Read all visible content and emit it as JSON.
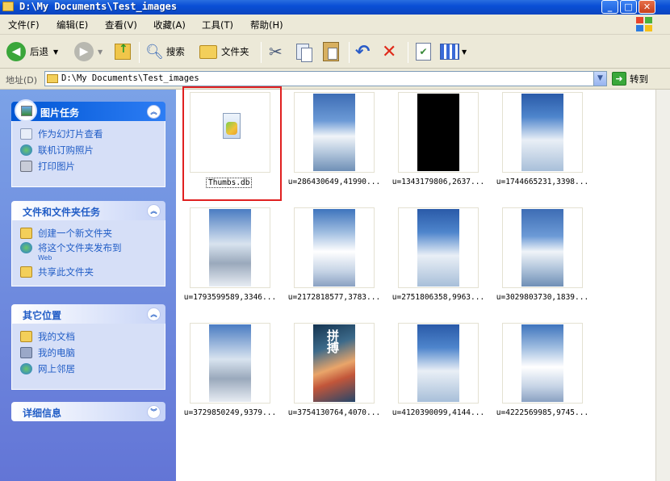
{
  "window": {
    "title": "D:\\My Documents\\Test_images"
  },
  "menu": [
    "文件(F)",
    "编辑(E)",
    "查看(V)",
    "收藏(A)",
    "工具(T)",
    "帮助(H)"
  ],
  "toolbar": {
    "back": "后退",
    "search": "搜索",
    "folders": "文件夹"
  },
  "address": {
    "label": "地址(D)",
    "path": "D:\\My Documents\\Test_images",
    "go": "转到"
  },
  "tasks": {
    "picture": {
      "title": "图片任务",
      "items": [
        "作为幻灯片查看",
        "联机订购照片",
        "打印图片"
      ]
    },
    "file": {
      "title": "文件和文件夹任务",
      "items": [
        "创建一个新文件夹",
        "将这个文件夹发布到",
        "Web",
        "共享此文件夹"
      ]
    },
    "other": {
      "title": "其它位置",
      "items": [
        "我的文档",
        "我的电脑",
        "网上邻居"
      ]
    },
    "details": {
      "title": "详细信息"
    }
  },
  "files": [
    {
      "name": "Thumbs.db",
      "kind": "db"
    },
    {
      "name": "u=286430649,41990...",
      "kind": "sky1"
    },
    {
      "name": "u=1343179806,2637...",
      "kind": "black"
    },
    {
      "name": "u=1744665231,3398...",
      "kind": "sky2"
    },
    {
      "name": "u=1793599589,3346...",
      "kind": "skyw"
    },
    {
      "name": "u=2172818577,3783...",
      "kind": "sky3"
    },
    {
      "name": "u=2751806358,9963...",
      "kind": "sky2"
    },
    {
      "name": "u=3029803730,1839...",
      "kind": "sky1"
    },
    {
      "name": "u=3729850249,9379...",
      "kind": "skyw"
    },
    {
      "name": "u=3754130764,4070...",
      "kind": "poster"
    },
    {
      "name": "u=4120390099,4144...",
      "kind": "sky2"
    },
    {
      "name": "u=4222569985,9745...",
      "kind": "sky3"
    }
  ],
  "poster_text": "拼搏"
}
